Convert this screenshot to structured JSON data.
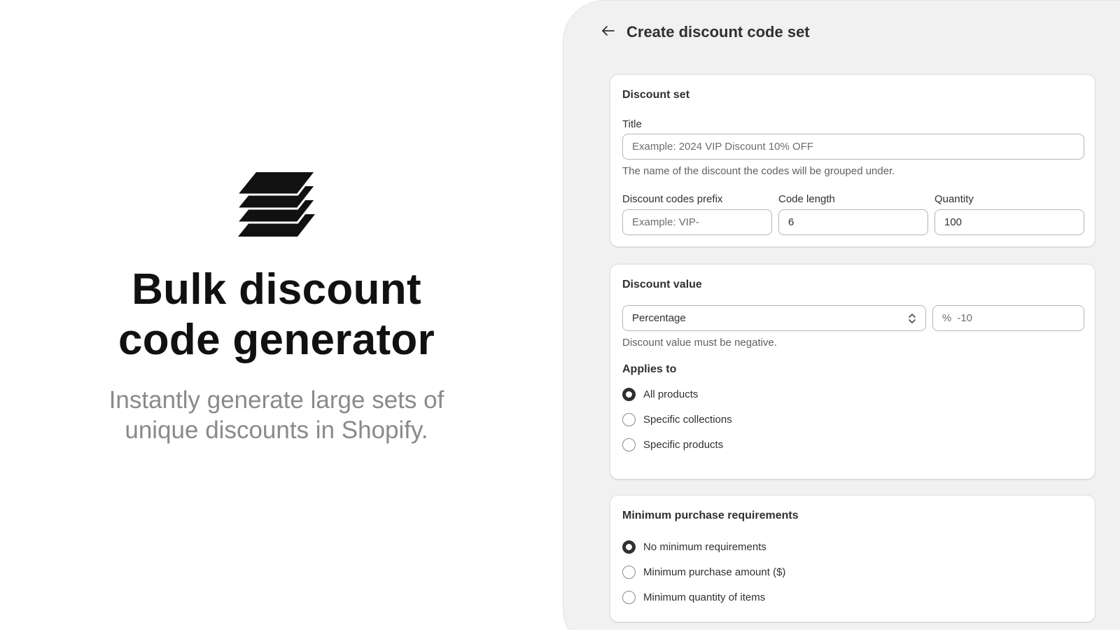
{
  "hero": {
    "logo_icon": "stacked-layers-icon",
    "title_line1": "Bulk discount",
    "title_line2": "code generator",
    "subtitle_line1": "Instantly generate large sets of",
    "subtitle_line2": "unique discounts in Shopify."
  },
  "app": {
    "back_icon": "arrow-left-icon",
    "title": "Create discount code set",
    "discount_set": {
      "heading": "Discount set",
      "title_label": "Title",
      "title_placeholder": "Example: 2024 VIP Discount 10% OFF",
      "title_help": "The name of the discount the codes will be grouped under.",
      "prefix_label": "Discount codes prefix",
      "prefix_placeholder": "Example: VIP-",
      "length_label": "Code length",
      "length_value": "6",
      "quantity_label": "Quantity",
      "quantity_value": "100"
    },
    "discount_value": {
      "heading": "Discount value",
      "type_selected": "Percentage",
      "value_prefix": "%",
      "value": "-10",
      "help": "Discount value must be negative.",
      "applies_heading": "Applies to",
      "applies_options": [
        "All products",
        "Specific collections",
        "Specific products"
      ],
      "applies_selected_index": 0
    },
    "minimum": {
      "heading": "Minimum purchase requirements",
      "options": [
        "No minimum requirements",
        "Minimum purchase amount ($)",
        "Minimum quantity of items"
      ],
      "selected_index": 0
    }
  },
  "colors": {
    "panel_bg": "#f1f1f1",
    "card_bg": "#ffffff",
    "text_primary": "#303030",
    "text_secondary": "#616161",
    "hero_subtitle": "#8a8a8a"
  }
}
